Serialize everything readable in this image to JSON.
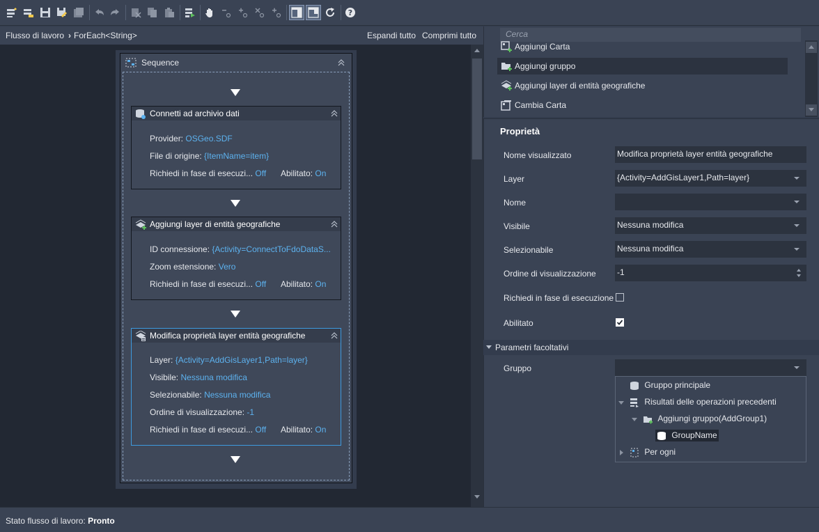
{
  "toolbar": {
    "buttons": [
      "new-workflow-icon",
      "open-workflow-icon",
      "save-icon",
      "save-as-icon",
      "save-all-icon",
      "undo-icon",
      "redo-icon",
      "cut-icon",
      "copy-icon",
      "paste-icon",
      "run-icon",
      "pan-icon",
      "zoom-out-icon",
      "zoom-in-icon",
      "zoom-reset-icon",
      "zoom-fit-icon",
      "layout-split-icon",
      "layout-panel-icon",
      "refresh-icon",
      "help-icon"
    ]
  },
  "designer": {
    "breadcrumb_root": "Flusso di lavoro",
    "breadcrumb_current": "ForEach<String>",
    "expand_all": "Espandi tutto",
    "collapse_all": "Comprimi tutto",
    "sequence_title": "Sequence",
    "activities": [
      {
        "title": "Connetti ad archivio dati",
        "rows": [
          {
            "label": "Provider:",
            "value": "OSGeo.SDF"
          },
          {
            "label": "File di origine:",
            "value": "{ItemName=item}"
          }
        ],
        "runtime_label": "Richiedi in fase di esecuzi...",
        "runtime_value": "Off",
        "enabled_label": "Abilitato:",
        "enabled_value": "On"
      },
      {
        "title": "Aggiungi layer di entità geografiche",
        "rows": [
          {
            "label": "ID connessione:",
            "value": "{Activity=ConnectToFdoDataS..."
          },
          {
            "label": "Zoom estensione:",
            "value": "Vero"
          }
        ],
        "runtime_label": "Richiedi in fase di esecuzi...",
        "runtime_value": "Off",
        "enabled_label": "Abilitato:",
        "enabled_value": "On"
      },
      {
        "title": "Modifica proprietà layer entità geografiche",
        "rows": [
          {
            "label": "Layer:",
            "value": "{Activity=AddGisLayer1,Path=layer}"
          },
          {
            "label": "Visibile:",
            "value": "Nessuna modifica"
          },
          {
            "label": "Selezionabile:",
            "value": "Nessuna modifica"
          },
          {
            "label": "Ordine di visualizzazione:",
            "value": "-1"
          }
        ],
        "runtime_label": "Richiedi in fase di esecuzi...",
        "runtime_value": "Off",
        "enabled_label": "Abilitato:",
        "enabled_value": "On"
      }
    ]
  },
  "toolbox": {
    "search_placeholder": "Cerca",
    "items": [
      "Aggiungi Carta",
      "Aggiungi gruppo",
      "Aggiungi layer di entità geografiche",
      "Cambia Carta"
    ]
  },
  "properties": {
    "title": "Proprietà",
    "display_name_label": "Nome visualizzato",
    "display_name_value": "Modifica proprietà layer entità geografiche",
    "layer_label": "Layer",
    "layer_value": "{Activity=AddGisLayer1,Path=layer}",
    "name_label": "Nome",
    "name_value": "",
    "visible_label": "Visibile",
    "visible_value": "Nessuna modifica",
    "selectable_label": "Selezionabile",
    "selectable_value": "Nessuna modifica",
    "draw_order_label": "Ordine di visualizzazione",
    "draw_order_value": "-1",
    "runtime_label": "Richiedi in fase di esecuzione",
    "runtime_checked": false,
    "enabled_label": "Abilitato",
    "enabled_checked": true,
    "optional_section": "Parametri facoltativi",
    "group_label": "Gruppo",
    "group_value": ""
  },
  "group_tree": {
    "root": "Gruppo principale",
    "previous_results": "Risultati delle operazioni precedenti",
    "add_group": "Aggiungi gruppo(AddGroup1)",
    "group_name": "GroupName",
    "for_each": "Per ogni"
  },
  "status": {
    "label": "Stato flusso di lavoro:",
    "value": "Pronto"
  }
}
